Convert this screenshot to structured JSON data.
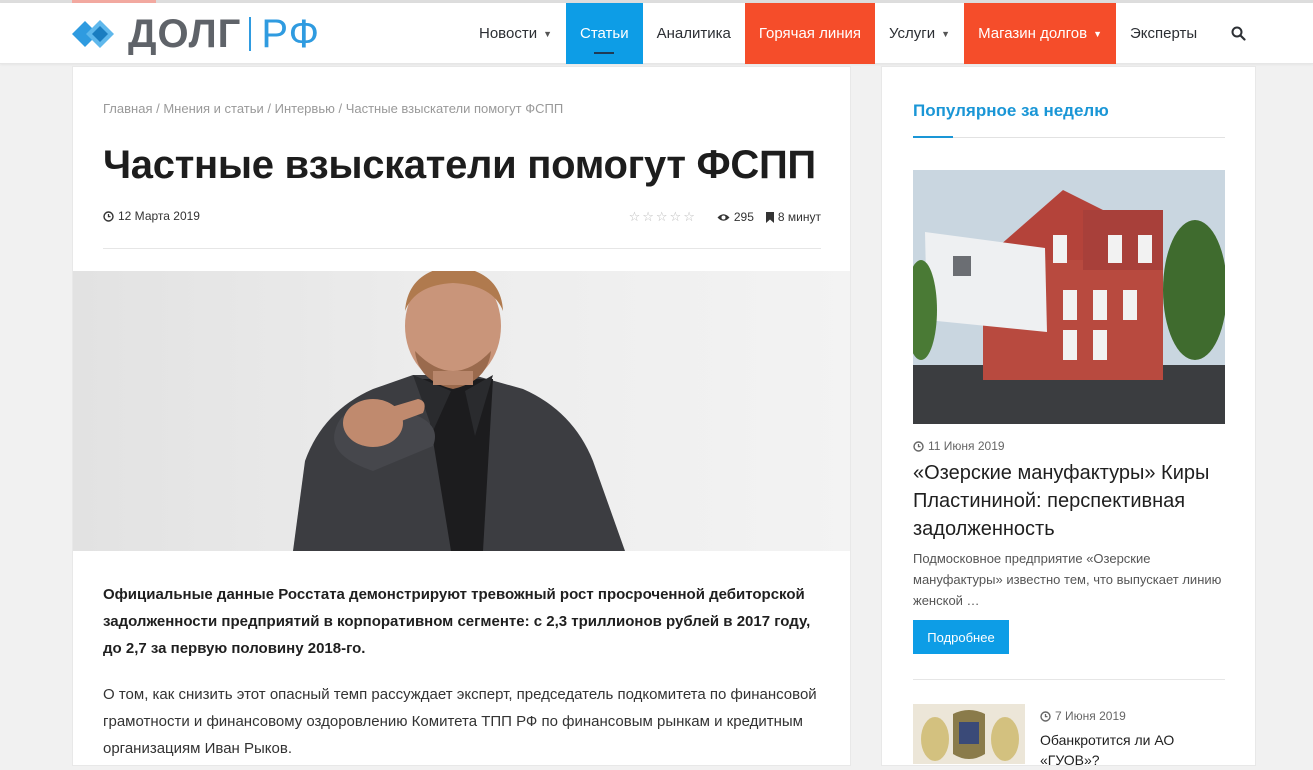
{
  "header": {
    "logo_text": "ДОЛГ",
    "logo_text_rf": "РФ",
    "nav": [
      {
        "label": "Новости",
        "dropdown": true
      },
      {
        "label": "Статьи",
        "active": true
      },
      {
        "label": "Аналитика"
      },
      {
        "label": "Горячая линия",
        "hot": true
      },
      {
        "label": "Услуги",
        "dropdown": true
      },
      {
        "label": "Магазин долгов",
        "hot": true,
        "dropdown": true
      },
      {
        "label": "Эксперты"
      }
    ],
    "search_icon": "search-icon"
  },
  "colors": {
    "accent_blue": "#0d9de6",
    "hot_red": "#f54d2a",
    "title_blue": "#1a96d6"
  },
  "article": {
    "breadcrumb": [
      "Главная",
      "Мнения и статьи",
      "Интервью",
      "Частные взыскатели помогут ФСПП"
    ],
    "breadcrumb_separator": " / ",
    "title": "Частные взыскатели помогут ФСПП",
    "date": "12 Марта 2019",
    "views": "295",
    "read_time": "8 минут",
    "rating_stars": "☆☆☆☆☆",
    "lead": "Официальные данные Росстата демонстрируют тревожный рост просроченной дебиторской задолженности предприятий в корпоративном сегменте: с 2,3 триллионов рублей в 2017 году, до 2,7 за первую половину 2018-го.",
    "paragraph": "О том, как снизить этот опасный темп рассуждает эксперт, председатель подкомитета по финансовой грамотности и финансовому оздоровлению Комитета ТПП РФ по финансовым рынкам и кредитным организациям Иван Рыков."
  },
  "sidebar": {
    "widget_title": "Популярное за неделю",
    "featured": {
      "date": "11 Июня 2019",
      "title": "«Озерские мануфактуры» Киры Пластининой: перспективная задолженность",
      "excerpt": "Подмосковное предприятие «Озерские мануфактуры» известно тем, что выпускает линию женской …",
      "button": "Подробнее"
    },
    "second": {
      "date": "7 Июня 2019",
      "title": "Обанкротится ли АО «ГУОВ»?"
    }
  }
}
